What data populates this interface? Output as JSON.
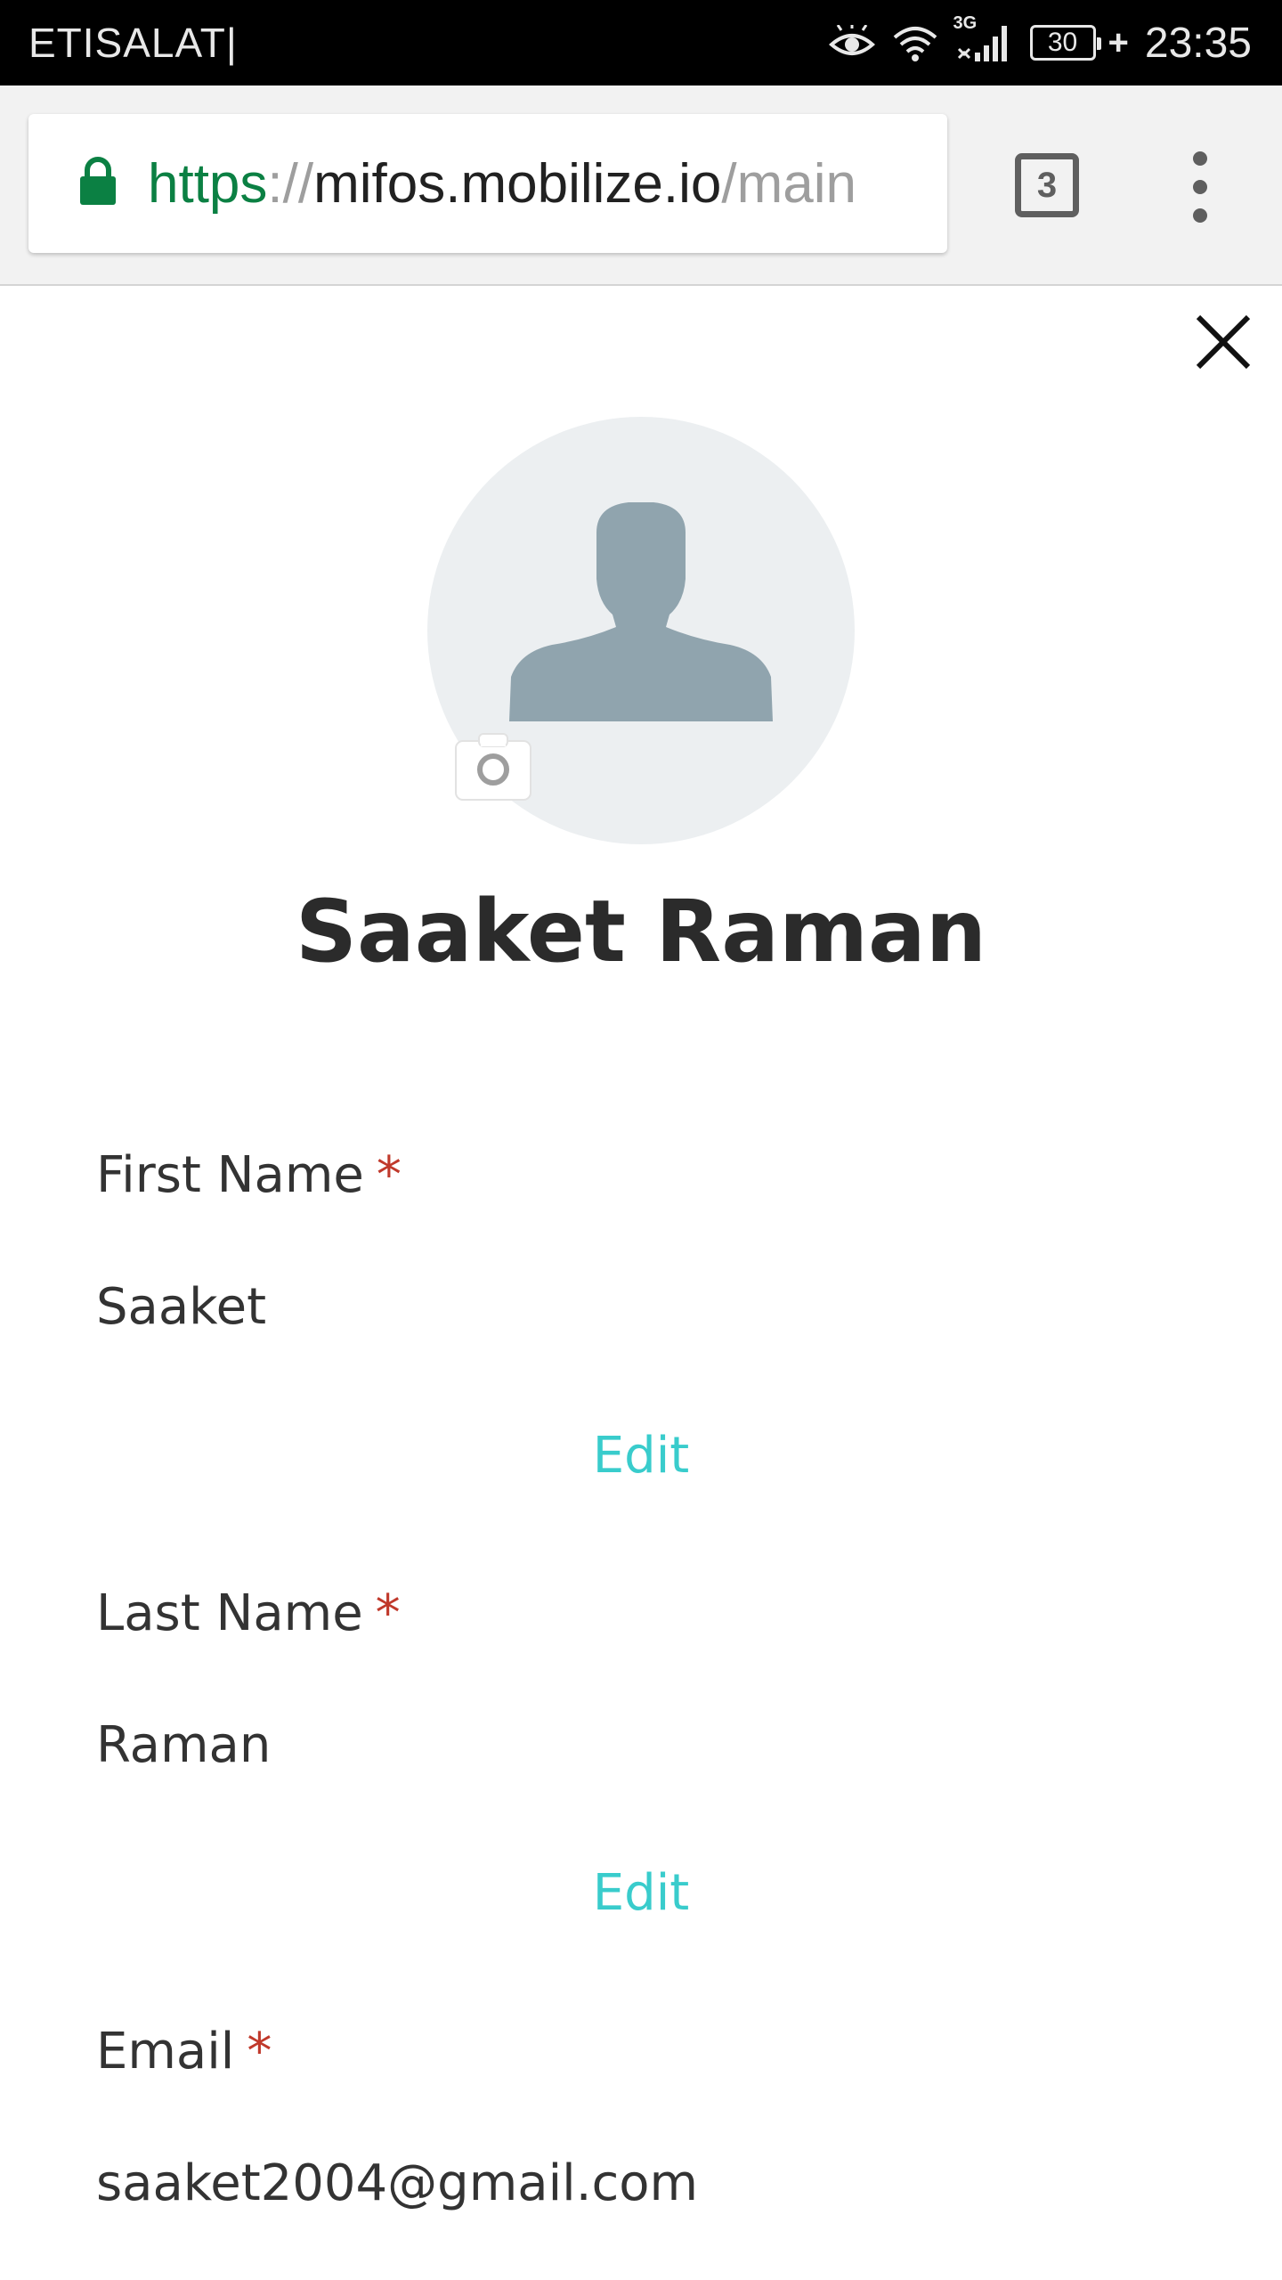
{
  "status_bar": {
    "carrier": "ETISALAT|",
    "network_type": "3G",
    "battery_level": "30",
    "charging_symbol": "+",
    "time": "23:35"
  },
  "browser": {
    "url_scheme": "https",
    "url_separator": "://",
    "url_host": "mifos.mobilize.io",
    "url_path": "/main",
    "tab_count": "3"
  },
  "profile": {
    "name": "Saaket Raman",
    "fields": [
      {
        "label": "First Name",
        "required_mark": "*",
        "value": "Saaket",
        "edit_label": "Edit"
      },
      {
        "label": "Last Name",
        "required_mark": "*",
        "value": "Raman",
        "edit_label": "Edit"
      },
      {
        "label": "Email",
        "required_mark": "*",
        "value": "saaket2004@gmail.com"
      }
    ]
  },
  "colors": {
    "status_bar_bg": "#000000",
    "secure_scheme": "#0b8043",
    "required_mark": "#c0392b",
    "edit_link": "#39cccc",
    "avatar_bg": "#eceff1",
    "avatar_silhouette": "#90a4ae"
  },
  "icons": {
    "lock": "lock-icon",
    "close": "close-icon",
    "camera": "camera-icon",
    "avatar": "user-silhouette-icon",
    "menu": "more-vert-icon",
    "eye": "eye-icon",
    "wifi": "wifi-icon",
    "signal": "signal-icon"
  }
}
